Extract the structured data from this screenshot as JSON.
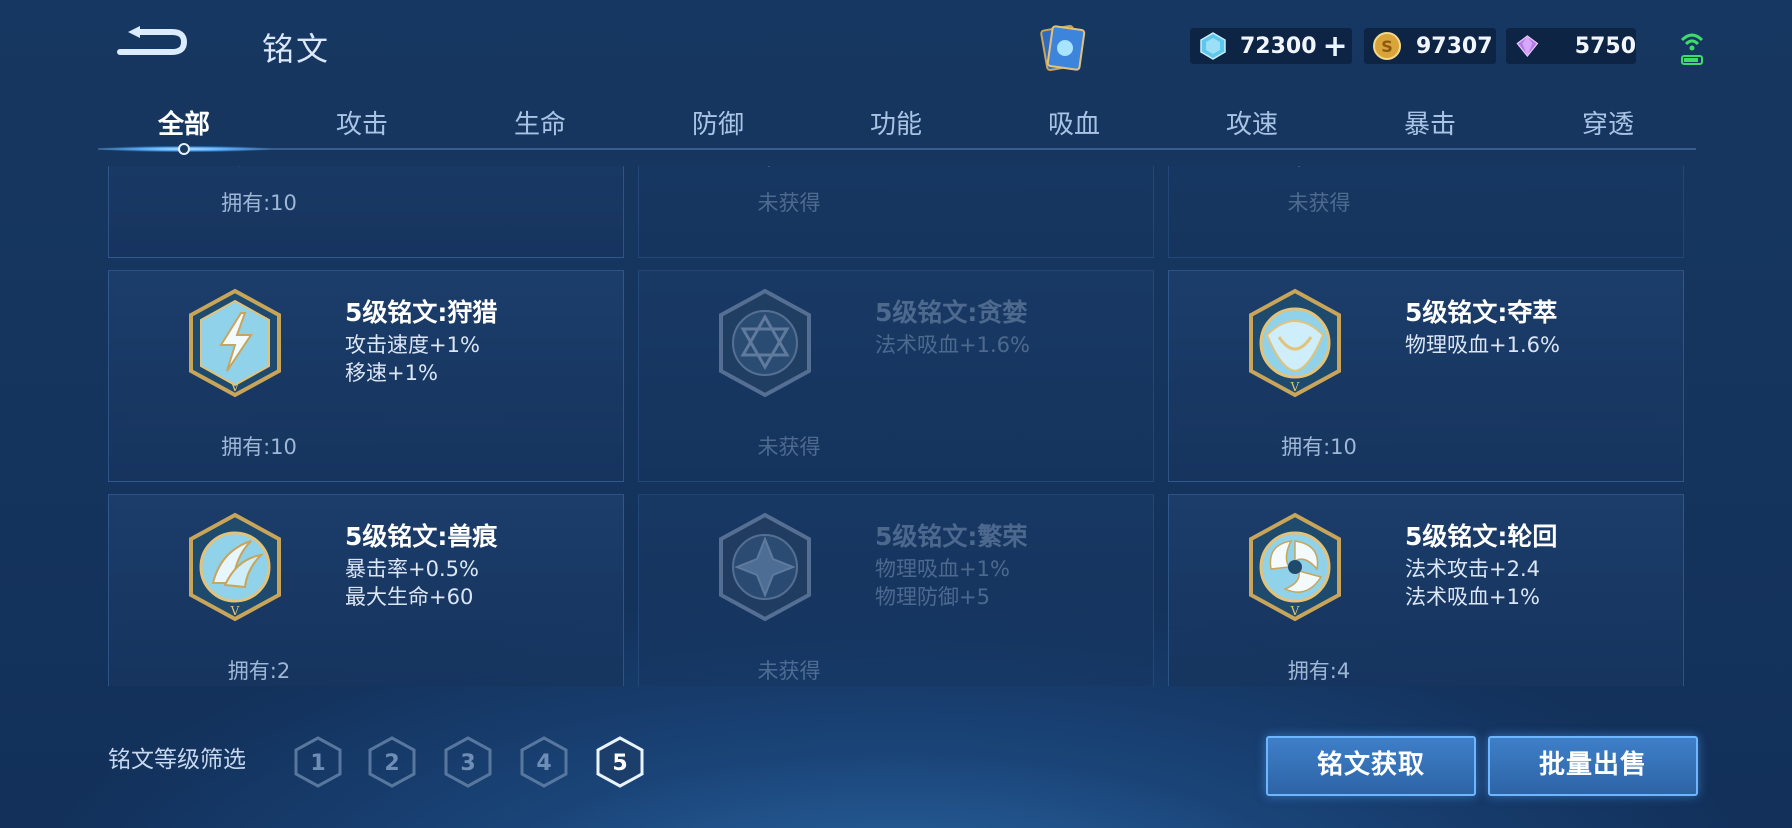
{
  "header": {
    "title": "铭文"
  },
  "currencies": {
    "diamond": {
      "value": "72300",
      "icon": "diamond-icon",
      "add": "+"
    },
    "gold": {
      "value": "97307",
      "icon": "gold-coin-icon"
    },
    "gem": {
      "value": "5750",
      "icon": "crystal-gem-icon"
    }
  },
  "tabs": [
    {
      "label": "全部"
    },
    {
      "label": "攻击"
    },
    {
      "label": "生命"
    },
    {
      "label": "防御"
    },
    {
      "label": "功能"
    },
    {
      "label": "吸血"
    },
    {
      "label": "攻速"
    },
    {
      "label": "暴击"
    },
    {
      "label": "穿透"
    }
  ],
  "cards": [
    {
      "owned": "拥有:10"
    },
    {
      "owned": "未获得"
    },
    {
      "owned": "未获得"
    },
    {
      "name": "5级铭文:狩猎",
      "attrs": [
        "攻击速度+1%",
        "移速+1%"
      ],
      "owned": "拥有:10",
      "icon": "lightning-rune-icon"
    },
    {
      "name": "5级铭文:贪婪",
      "attrs": [
        "法术吸血+1.6%"
      ],
      "owned": "未获得",
      "icon": "hexagram-rune-icon"
    },
    {
      "name": "5级铭文:夺萃",
      "attrs": [
        "物理吸血+1.6%"
      ],
      "owned": "拥有:10",
      "icon": "knot-rune-icon"
    },
    {
      "name": "5级铭文:兽痕",
      "attrs": [
        "暴击率+0.5%",
        "最大生命+60"
      ],
      "owned": "拥有:2",
      "icon": "claw-rune-icon"
    },
    {
      "name": "5级铭文:繁荣",
      "attrs": [
        "物理吸血+1%",
        "物理防御+5"
      ],
      "owned": "未获得",
      "icon": "star-rune-icon"
    },
    {
      "name": "5级铭文:轮回",
      "attrs": [
        "法术攻击+2.4",
        "法术吸血+1%"
      ],
      "owned": "拥有:4",
      "icon": "swirl-rune-icon"
    }
  ],
  "filter": {
    "label": "铭文等级筛选",
    "levels": [
      "1",
      "2",
      "3",
      "4",
      "5"
    ],
    "selected": "5"
  },
  "buttons": {
    "obtain": "铭文获取",
    "sell": "批量出售"
  },
  "colors": {
    "accent": "#6db6ff",
    "background": "#15355e",
    "gold": "#c9a55a",
    "rune": "#8fd2ea"
  }
}
